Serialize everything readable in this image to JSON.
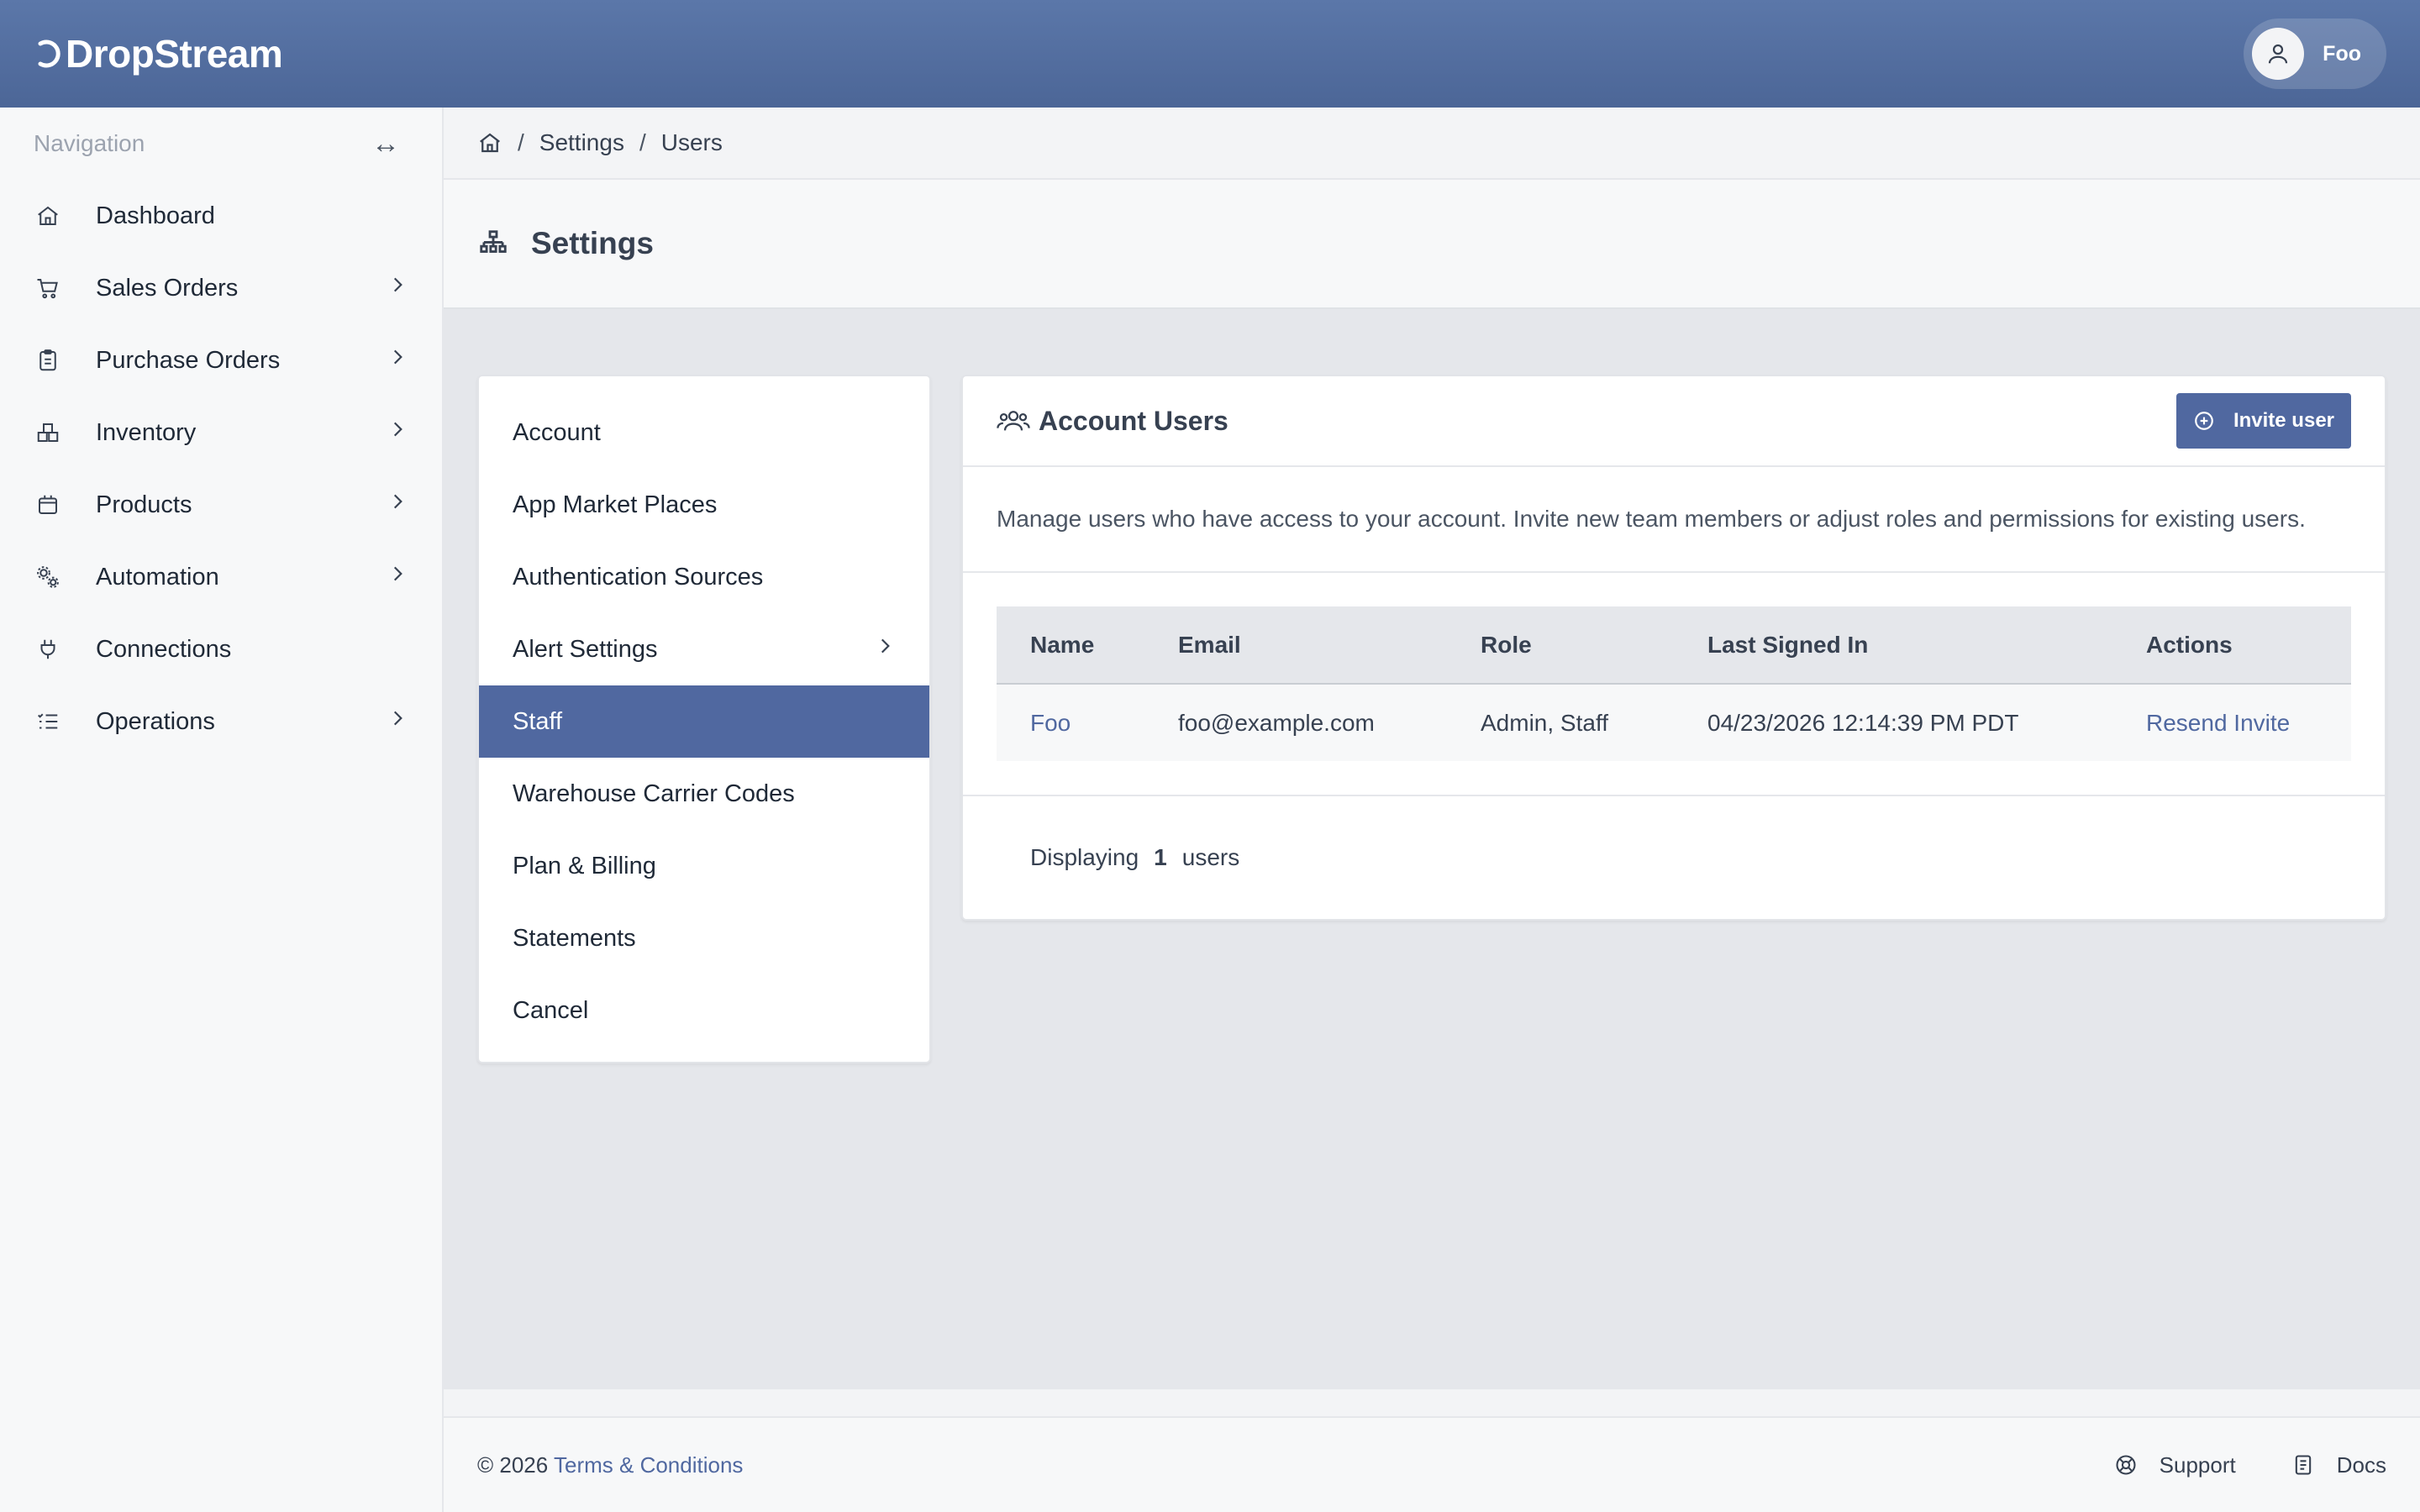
{
  "app": {
    "logo_text": "DropStream"
  },
  "user": {
    "name": "Foo",
    "icon": "user-icon"
  },
  "sidebar": {
    "heading": "Navigation",
    "collapse_glyph": "↔",
    "items": [
      {
        "label": "Dashboard",
        "icon": "home-icon",
        "has_children": false
      },
      {
        "label": "Sales Orders",
        "icon": "cart-icon",
        "has_children": true
      },
      {
        "label": "Purchase Orders",
        "icon": "clipboard-icon",
        "has_children": true
      },
      {
        "label": "Inventory",
        "icon": "boxes-icon",
        "has_children": true
      },
      {
        "label": "Products",
        "icon": "package-icon",
        "has_children": true
      },
      {
        "label": "Automation",
        "icon": "gears-icon",
        "has_children": true
      },
      {
        "label": "Connections",
        "icon": "plug-icon",
        "has_children": false
      },
      {
        "label": "Operations",
        "icon": "list-check-icon",
        "has_children": true
      }
    ]
  },
  "breadcrumb": {
    "items": [
      "Settings",
      "Users"
    ],
    "separator": "/"
  },
  "page": {
    "title": "Settings"
  },
  "settings_menu": {
    "items": [
      {
        "label": "Account"
      },
      {
        "label": "App Market Places"
      },
      {
        "label": "Authentication Sources"
      },
      {
        "label": "Alert Settings",
        "has_children": true
      },
      {
        "label": "Staff",
        "active": true
      },
      {
        "label": "Warehouse Carrier Codes"
      },
      {
        "label": "Plan & Billing"
      },
      {
        "label": "Statements"
      },
      {
        "label": "Cancel"
      }
    ]
  },
  "users_card": {
    "title": "Account Users",
    "invite_label": "Invite user",
    "description": "Manage users who have access to your account. Invite new team members or adjust roles and permissions for existing users.",
    "columns": [
      "Name",
      "Email",
      "Role",
      "Last Signed In",
      "Actions"
    ],
    "rows": [
      {
        "name": "Foo",
        "email": "foo@example.com",
        "role": "Admin, Staff",
        "last_signed_in": "04/23/2026 12:14:39 PM PDT",
        "action": "Resend Invite"
      }
    ],
    "footer_prefix": "Displaying",
    "footer_count": "1",
    "footer_suffix": "users"
  },
  "footer": {
    "copyright": "© 2026",
    "terms_label": "Terms & Conditions",
    "support_label": "Support",
    "docs_label": "Docs"
  },
  "colors": {
    "brand": "#5068a0",
    "topbar": "#5b77a9",
    "link": "#5068a0"
  }
}
